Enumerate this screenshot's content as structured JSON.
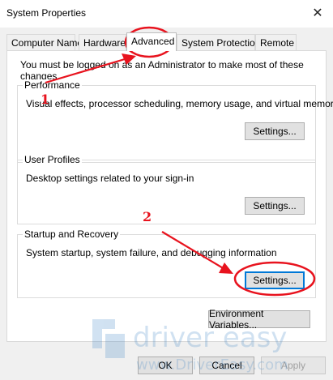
{
  "window": {
    "title": "System Properties"
  },
  "tabs": [
    {
      "label": "Computer Name",
      "active": false
    },
    {
      "label": "Hardware",
      "active": false
    },
    {
      "label": "Advanced",
      "active": true
    },
    {
      "label": "System Protection",
      "active": false
    },
    {
      "label": "Remote",
      "active": false
    }
  ],
  "note": "You must be logged on as an Administrator to make most of these changes.",
  "groups": {
    "performance": {
      "title": "Performance",
      "desc": "Visual effects, processor scheduling, memory usage, and virtual memory",
      "button": "Settings..."
    },
    "user_profiles": {
      "title": "User Profiles",
      "desc": "Desktop settings related to your sign-in",
      "button": "Settings..."
    },
    "startup": {
      "title": "Startup and Recovery",
      "desc": "System startup, system failure, and debugging information",
      "button": "Settings..."
    }
  },
  "env_button": "Environment Variables...",
  "footer": {
    "ok": "OK",
    "cancel": "Cancel",
    "apply": "Apply"
  },
  "annotations": {
    "step1": "1",
    "step2": "2",
    "color": "#e8131e"
  },
  "watermark": {
    "brand": "driver easy",
    "url": "www.DriverEasy.com"
  }
}
